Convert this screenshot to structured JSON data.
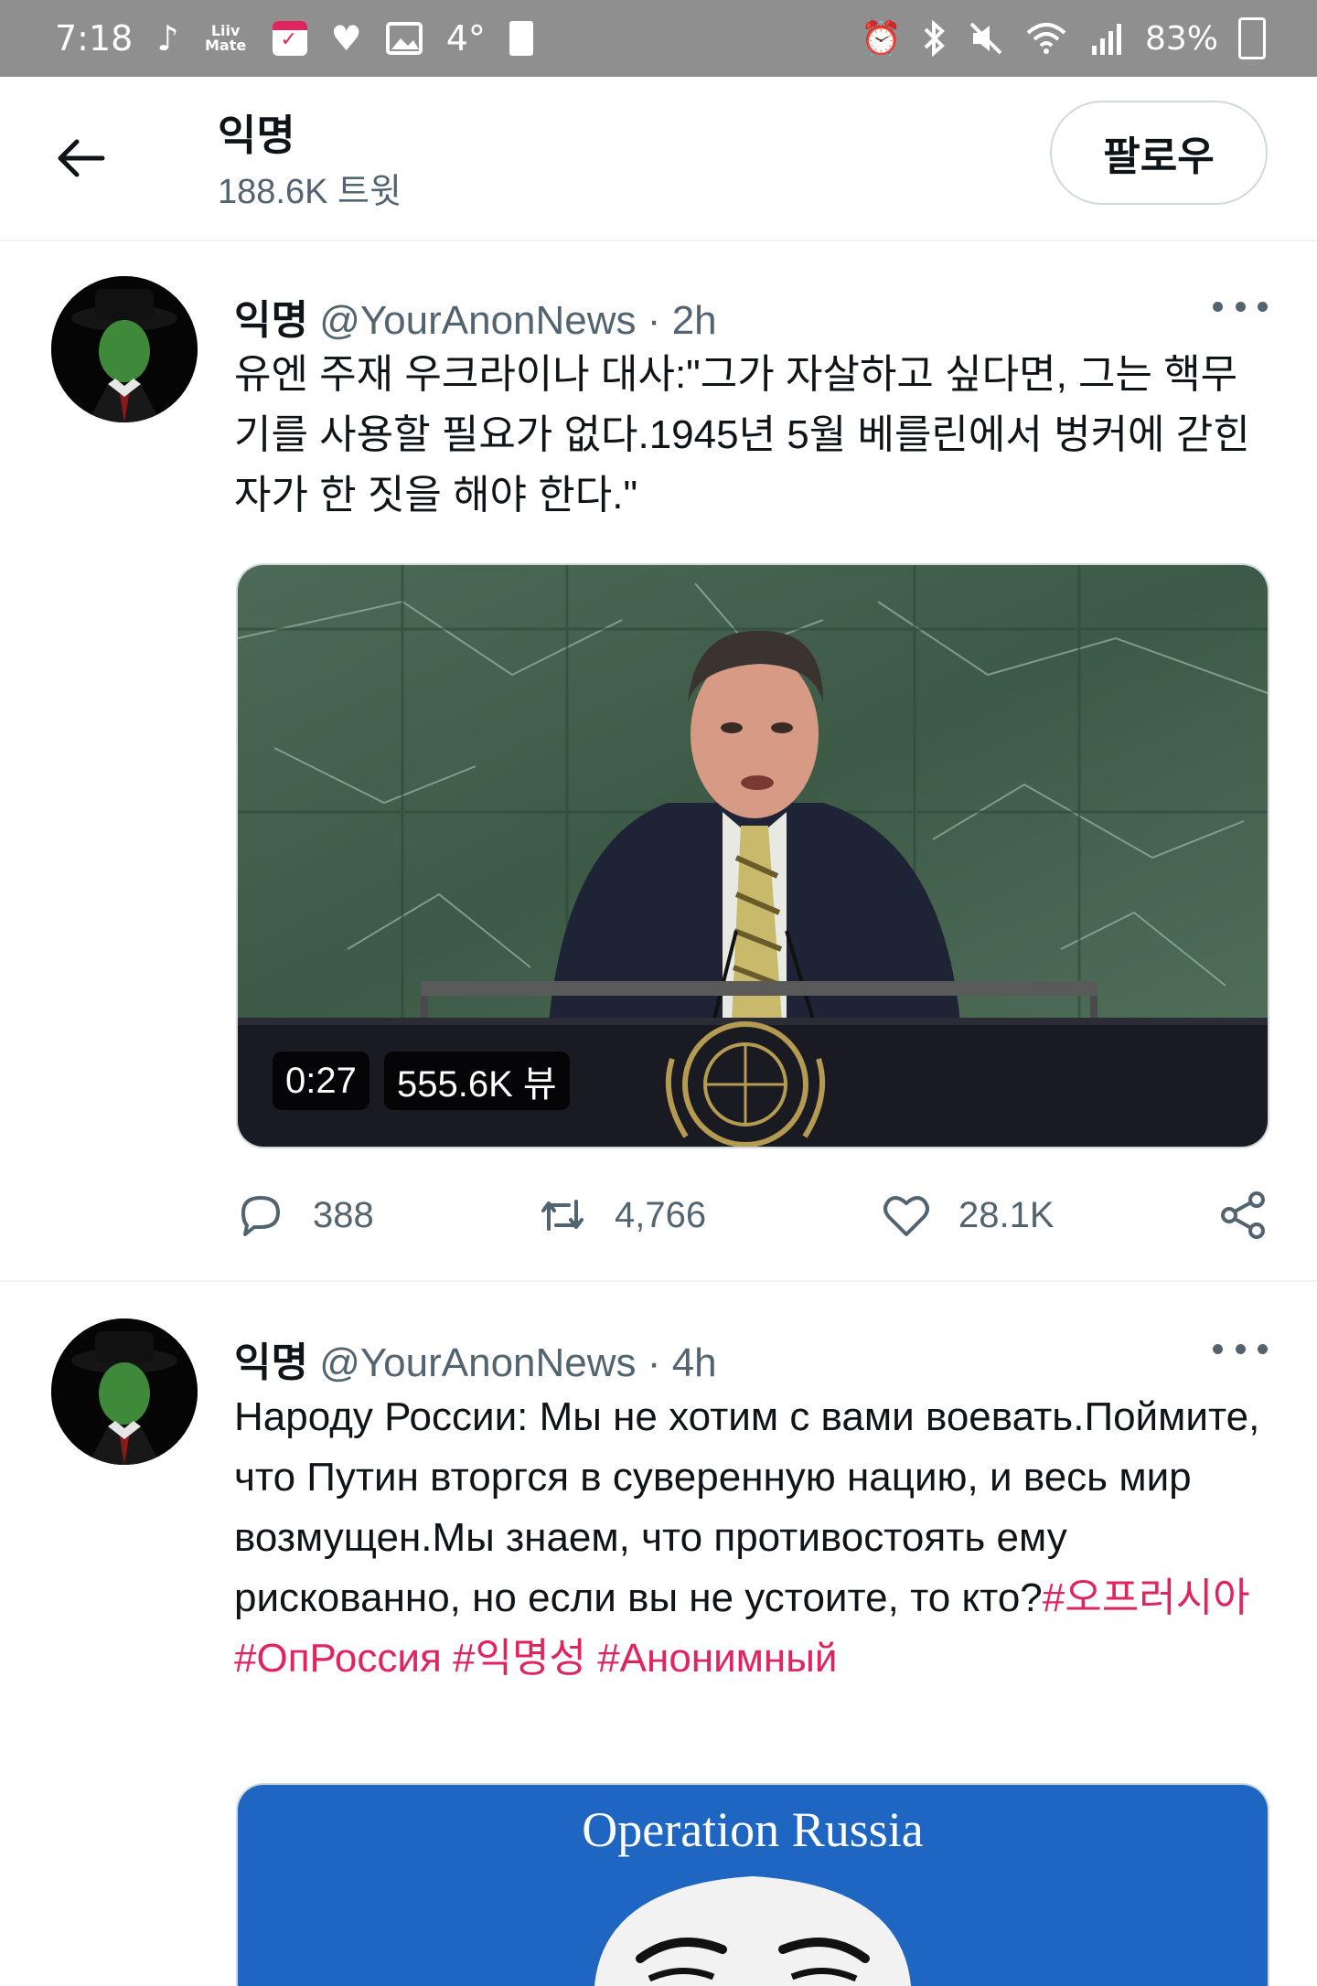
{
  "status_bar": {
    "time": "7:18",
    "liiv_label": "Liiv Mate",
    "temperature": "4°",
    "battery": "83%"
  },
  "header": {
    "title": "익명",
    "subtitle": "188.6K 트윗",
    "follow_label": "팔로우"
  },
  "tweets": [
    {
      "name": "익명",
      "handle": "@YourAnonNews",
      "separator": "·",
      "time": "2h",
      "text": "유엔 주재 우크라이나 대사:\"그가 자살하고 싶다면, 그는 핵무기를 사용할 필요가 없다.1945년 5월 베를린에서 벙커에 갇힌 자가 한 짓을 해야 한다.\"",
      "video_duration": "0:27",
      "video_views": "555.6K 뷰",
      "replies": "388",
      "retweets": "4,766",
      "likes": "28.1K"
    },
    {
      "name": "익명",
      "handle": "@YourAnonNews",
      "separator": "·",
      "time": "4h",
      "text": "Народу России: Мы не хотим с вами воевать.Поймите, что Путин вторгся в суверенную нацию, и весь мир возмущен.Мы знаем, что противостоять ему рискованно, но если вы не устоите, то кто?",
      "hashtags": [
        "#오프러시아",
        "#ОпРоссия",
        "#익명성",
        "#Анонимный"
      ],
      "media_title": "Operation Russia"
    }
  ],
  "colors": {
    "hashtag": "#e0245e",
    "secondary_text": "#536471",
    "status_bar_bg": "#8f8f8f",
    "media_blue": "#1f66c2"
  }
}
